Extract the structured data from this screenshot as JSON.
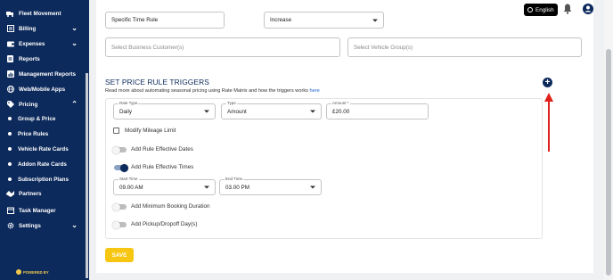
{
  "sidebar": {
    "items": [
      {
        "label": "Fleet Movement",
        "icon": "truck-icon",
        "chevron": false
      },
      {
        "label": "Billing",
        "icon": "billing-icon",
        "chevron": true
      },
      {
        "label": "Expenses",
        "icon": "wallet-icon",
        "chevron": true
      },
      {
        "label": "Reports",
        "icon": "report-icon",
        "chevron": false
      },
      {
        "label": "Management Reports",
        "icon": "chart-icon",
        "chevron": false
      },
      {
        "label": "Web/Mobile Apps",
        "icon": "globe-icon",
        "chevron": false
      },
      {
        "label": "Pricing",
        "icon": "tag-icon",
        "chevron": true
      }
    ],
    "pricing_sub": [
      {
        "label": "Group & Price"
      },
      {
        "label": "Price Rules"
      },
      {
        "label": "Vehicle Rate Cards"
      },
      {
        "label": "Addon Rate Cards"
      },
      {
        "label": "Subscription Plans"
      }
    ],
    "bottom_items": [
      {
        "label": "Partners",
        "icon": "handshake-icon",
        "chevron": false
      },
      {
        "label": "Task Manager",
        "icon": "calendar-icon",
        "chevron": false
      },
      {
        "label": "Settings",
        "icon": "gear-icon",
        "chevron": true
      }
    ],
    "powered_by": "POWERED BY",
    "brand_color": "#0d2a5c"
  },
  "topbar": {
    "language": "English"
  },
  "form": {
    "rule_type_value": "Specific Time Rule",
    "adjustment_value": "Increase",
    "business_customer_placeholder": "Select Business Customer(s)",
    "vehicle_group_placeholder": "Select Vehicle Group(s)"
  },
  "triggers": {
    "title": "SET PRICE RULE TRIGGERS",
    "subtitle": "Read more about automating seasonal pricing using Rate Matrix and how the triggers works",
    "link_text": "here",
    "add_label": "+",
    "rate_type": {
      "label": "Rate Type",
      "value": "Daily"
    },
    "type": {
      "label": "Type",
      "value": "Amount"
    },
    "amount": {
      "label": "Amount *",
      "value": "£20.00"
    },
    "modify_mileage": {
      "label": "Modify Mileage Limit",
      "checked": false
    },
    "effective_dates": {
      "label": "Add Rule Effective Dates",
      "on": false
    },
    "effective_times": {
      "label": "Add Rule Effective Times",
      "on": true
    },
    "start_time": {
      "label": "Start Time",
      "value": "09.00 AM"
    },
    "end_time": {
      "label": "End Time",
      "value": "03.00 PM"
    },
    "min_booking": {
      "label": "Add Minimum Booking Duration",
      "on": false
    },
    "pickup_dropoff": {
      "label": "Add Pickup/Dropoff Day(s)",
      "on": false
    }
  },
  "save_label": "SAVE",
  "colors": {
    "navy": "#0d2a5c",
    "save": "#f7c613",
    "annotation_arrow": "#e0201b"
  }
}
